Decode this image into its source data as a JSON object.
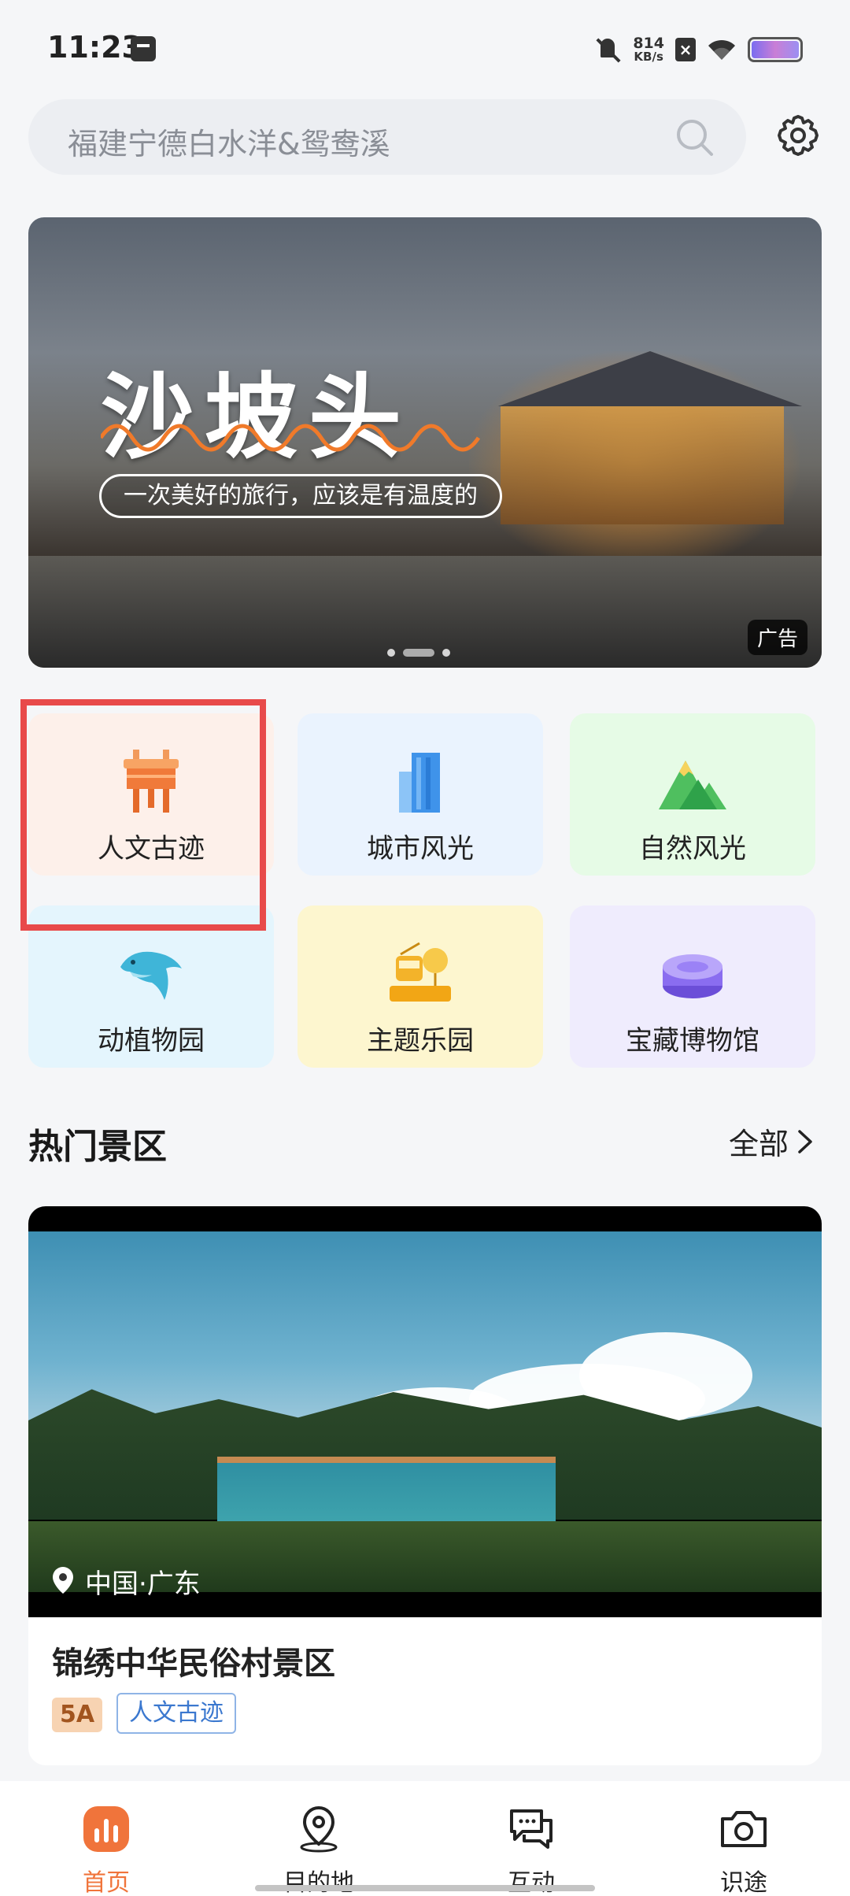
{
  "status_bar": {
    "time": "11:23",
    "net_speed": "814",
    "net_unit": "KB/s"
  },
  "search": {
    "placeholder": "福建宁德白水洋&鸳鸯溪"
  },
  "banner": {
    "title": "沙坡头",
    "slogan": "一次美好的旅行，应该是有温度的",
    "ad_label": "广告"
  },
  "categories": [
    {
      "label": "人文古迹",
      "icon": "ancient-vessel-icon",
      "bg": "#fdf0ea",
      "selected": true
    },
    {
      "label": "城市风光",
      "icon": "city-building-icon",
      "bg": "#eaf3fe"
    },
    {
      "label": "自然风光",
      "icon": "mountain-icon",
      "bg": "#e6fbe6"
    },
    {
      "label": "动植物园",
      "icon": "dolphin-icon",
      "bg": "#e4f5fd"
    },
    {
      "label": "主题乐园",
      "icon": "amusement-park-icon",
      "bg": "#fdf6cf"
    },
    {
      "label": "宝藏博物馆",
      "icon": "museum-icon",
      "bg": "#efecfd"
    }
  ],
  "hot_section": {
    "title": "热门景区",
    "see_all": "全部"
  },
  "featured_spot": {
    "location": "中国·广东",
    "name": "锦绣中华民俗村景区",
    "rating_tag": "5A",
    "category_tag": "人文古迹"
  },
  "tabs": [
    {
      "label": "首页",
      "icon": "home-chart-icon",
      "active": true
    },
    {
      "label": "目的地",
      "icon": "map-pin-icon"
    },
    {
      "label": "互动",
      "icon": "chat-bubbles-icon"
    },
    {
      "label": "识途",
      "icon": "camera-icon"
    }
  ],
  "colors": {
    "accent": "#f0743b",
    "highlight": "#e84a4a",
    "tag_blue": "#3b78cf"
  }
}
